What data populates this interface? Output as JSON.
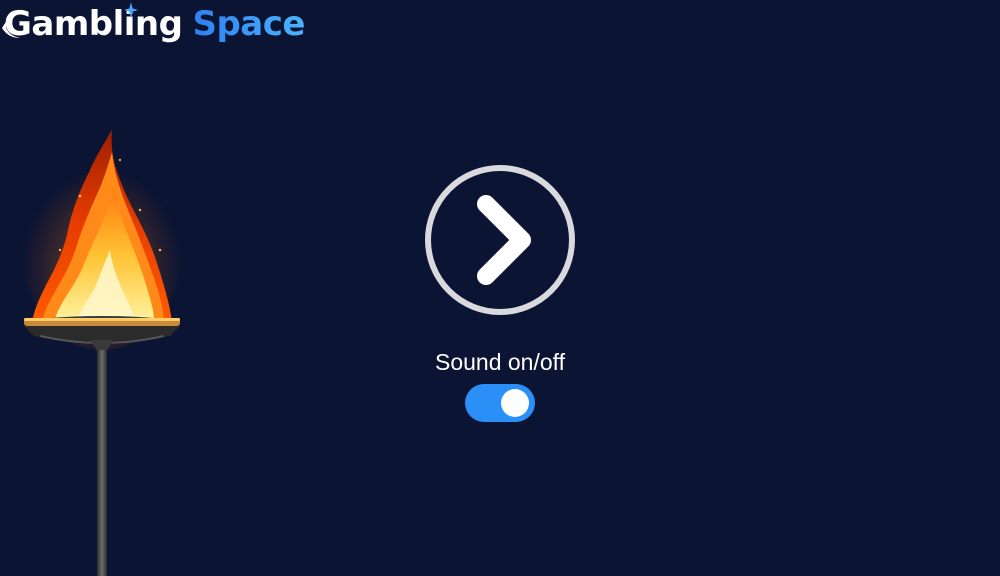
{
  "logo": {
    "word1": "Gambling",
    "word2": "Space"
  },
  "play_button": {
    "icon": "chevron-right-icon"
  },
  "sound": {
    "label": "Sound on/off",
    "state": "on"
  },
  "colors": {
    "background": "#0b1533",
    "accent": "#2a8ff7",
    "play_ring": "#d9d9dd"
  }
}
